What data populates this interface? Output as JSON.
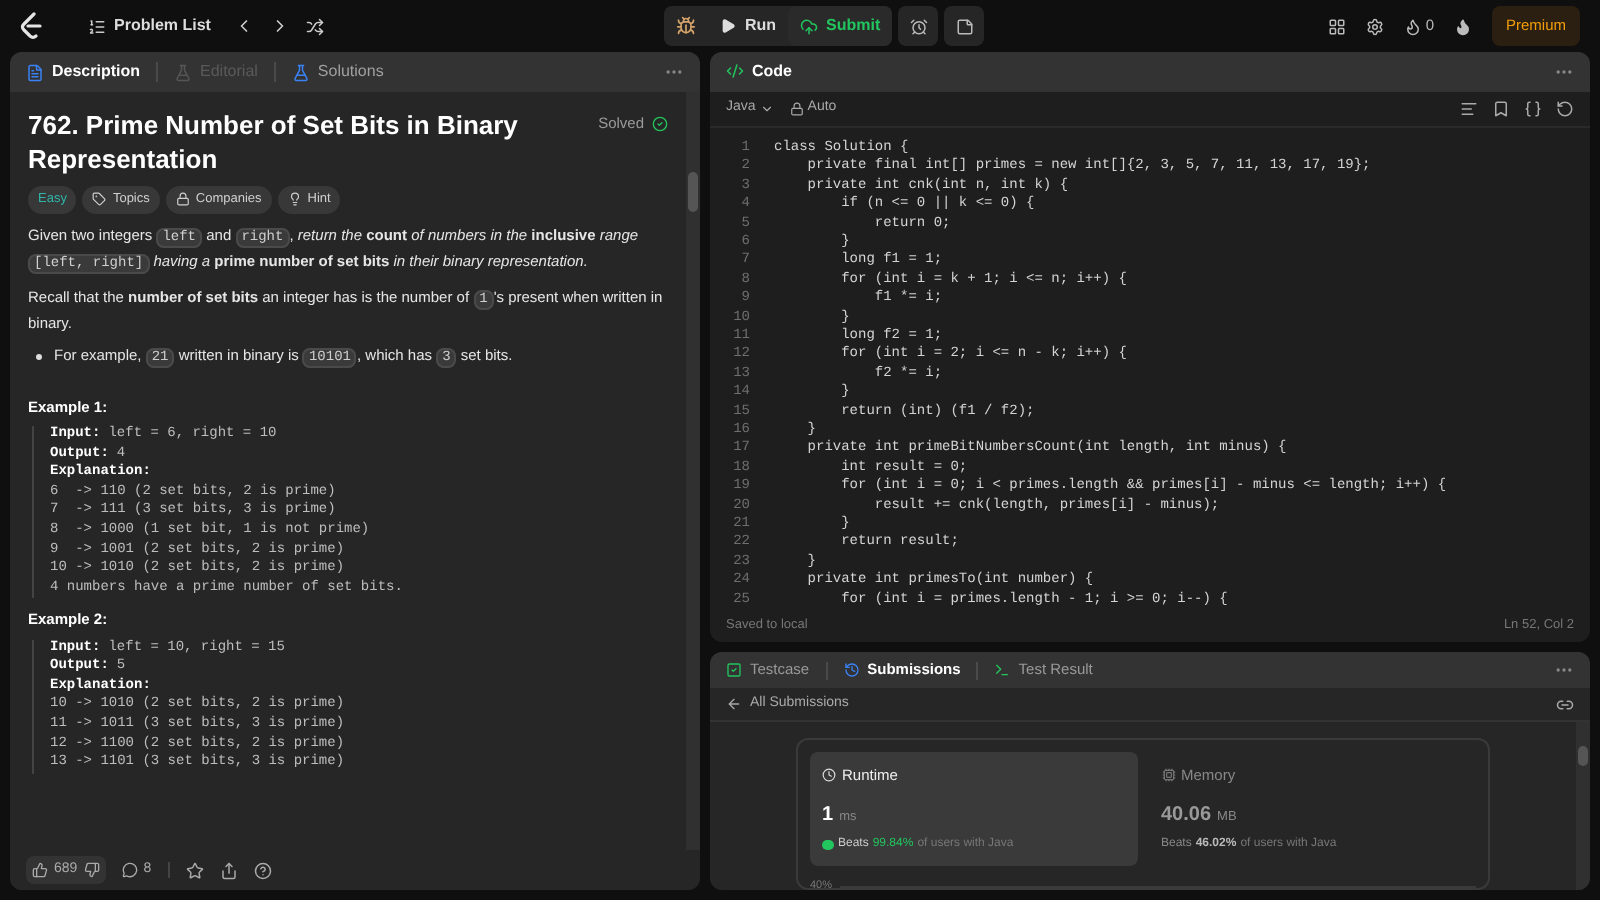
{
  "topbar": {
    "problem_list": "Problem List",
    "run": "Run",
    "submit": "Submit",
    "streak": "0",
    "premium": "Premium"
  },
  "description_panel": {
    "tabs": [
      {
        "label": "Description",
        "selected": true,
        "disabled": false
      },
      {
        "label": "Editorial",
        "selected": false,
        "disabled": true
      },
      {
        "label": "Solutions",
        "selected": false,
        "disabled": false
      }
    ],
    "title": "762. Prime Number of Set Bits in Binary Representation",
    "status": "Solved",
    "tags": [
      {
        "kind": "difficulty",
        "label": "Easy"
      },
      {
        "kind": "topics",
        "label": "Topics"
      },
      {
        "kind": "companies",
        "label": "Companies"
      },
      {
        "kind": "hint",
        "label": "Hint"
      }
    ],
    "paragraphs": [
      [
        {
          "kind": "text",
          "text": "Given two integers "
        },
        {
          "kind": "code",
          "text": "left"
        },
        {
          "kind": "text",
          "text": " and "
        },
        {
          "kind": "code",
          "text": "right"
        },
        {
          "kind": "text",
          "text": ", *return the* **count** *of numbers in the* **inclusive** *range* "
        },
        {
          "kind": "code",
          "text": "[left, right]"
        },
        {
          "kind": "text",
          "text": " *having a* **prime number of set bits** *in their binary representation.*"
        }
      ],
      [
        {
          "kind": "text",
          "text": "Recall that the **number of set bits** an integer has is the number of "
        },
        {
          "kind": "code",
          "text": "1"
        },
        {
          "kind": "text",
          "text": "'s present when written in binary."
        }
      ]
    ],
    "bullets": [
      [
        {
          "kind": "text",
          "text": "For example, "
        },
        {
          "kind": "code",
          "text": "21"
        },
        {
          "kind": "text",
          "text": " written in binary is "
        },
        {
          "kind": "code",
          "text": "10101"
        },
        {
          "kind": "text",
          "text": ", which has "
        },
        {
          "kind": "code",
          "text": "3"
        },
        {
          "kind": "text",
          "text": " set bits."
        }
      ]
    ],
    "examples": [
      {
        "heading": "Example 1:",
        "input_label": "Input:",
        "input": "left = 6, right = 10",
        "output_label": "Output:",
        "output": "4",
        "explanation_label": "Explanation:",
        "explanation": [
          "6  -> 110 (2 set bits, 2 is prime)",
          "7  -> 111 (3 set bits, 3 is prime)",
          "8  -> 1000 (1 set bit, 1 is not prime)",
          "9  -> 1001 (2 set bits, 2 is prime)",
          "10 -> 1010 (2 set bits, 2 is prime)",
          "4 numbers have a prime number of set bits."
        ]
      },
      {
        "heading": "Example 2:",
        "input_label": "Input:",
        "input": "left = 10, right = 15",
        "output_label": "Output:",
        "output": "5",
        "explanation_label": "Explanation:",
        "explanation": [
          "10 -> 1010 (2 set bits, 2 is prime)",
          "11 -> 1011 (3 set bits, 3 is prime)",
          "12 -> 1100 (2 set bits, 2 is prime)",
          "13 -> 1101 (3 set bits, 3 is prime)"
        ]
      }
    ],
    "footer": {
      "likes": "689",
      "comments": "8"
    }
  },
  "code_panel": {
    "title": "Code",
    "language": "Java",
    "mode": "Auto",
    "lines": [
      {
        "n": "1",
        "code": "class Solution {"
      },
      {
        "n": "2",
        "code": "    private final int[] primes = new int[]{2, 3, 5, 7, 11, 13, 17, 19};"
      },
      {
        "n": "3",
        "code": "    private int cnk(int n, int k) {"
      },
      {
        "n": "4",
        "code": "        if (n <= 0 || k <= 0) {"
      },
      {
        "n": "5",
        "code": "            return 0;"
      },
      {
        "n": "6",
        "code": "        }"
      },
      {
        "n": "7",
        "code": "        long f1 = 1;"
      },
      {
        "n": "8",
        "code": "        for (int i = k + 1; i <= n; i++) {"
      },
      {
        "n": "9",
        "code": "            f1 *= i;"
      },
      {
        "n": "10",
        "code": "        }"
      },
      {
        "n": "11",
        "code": "        long f2 = 1;"
      },
      {
        "n": "12",
        "code": "        for (int i = 2; i <= n - k; i++) {"
      },
      {
        "n": "13",
        "code": "            f2 *= i;"
      },
      {
        "n": "14",
        "code": "        }"
      },
      {
        "n": "15",
        "code": "        return (int) (f1 / f2);"
      },
      {
        "n": "16",
        "code": "    }"
      },
      {
        "n": "17",
        "code": "    private int primeBitNumbersCount(int length, int minus) {"
      },
      {
        "n": "18",
        "code": "        int result = 0;"
      },
      {
        "n": "19",
        "code": "        for (int i = 0; i < primes.length && primes[i] - minus <= length; i++) {"
      },
      {
        "n": "20",
        "code": "            result += cnk(length, primes[i] - minus);"
      },
      {
        "n": "21",
        "code": "        }"
      },
      {
        "n": "22",
        "code": "        return result;"
      },
      {
        "n": "23",
        "code": "    }"
      },
      {
        "n": "24",
        "code": "    private int primesTo(int number) {"
      },
      {
        "n": "25",
        "code": "        for (int i = primes.length - 1; i >= 0; i--) {"
      }
    ],
    "saved": "Saved to local",
    "cursor": "Ln 52, Col 2"
  },
  "result_panel": {
    "tabs": [
      {
        "label": "Testcase",
        "selected": false
      },
      {
        "label": "Submissions",
        "selected": true
      },
      {
        "label": "Test Result",
        "selected": false
      }
    ],
    "back": "All Submissions",
    "stats": [
      {
        "kind": "runtime",
        "label": "Runtime",
        "selected": true,
        "value": "1",
        "unit": "ms",
        "beats": "Beats",
        "percent": "99.84%",
        "suffix": "of users with Java"
      },
      {
        "kind": "memory",
        "label": "Memory",
        "selected": false,
        "value": "40.06",
        "unit": "MB",
        "beats": "Beats",
        "percent": "46.02%",
        "suffix": "of users with Java"
      }
    ],
    "axis_label": "40%"
  }
}
